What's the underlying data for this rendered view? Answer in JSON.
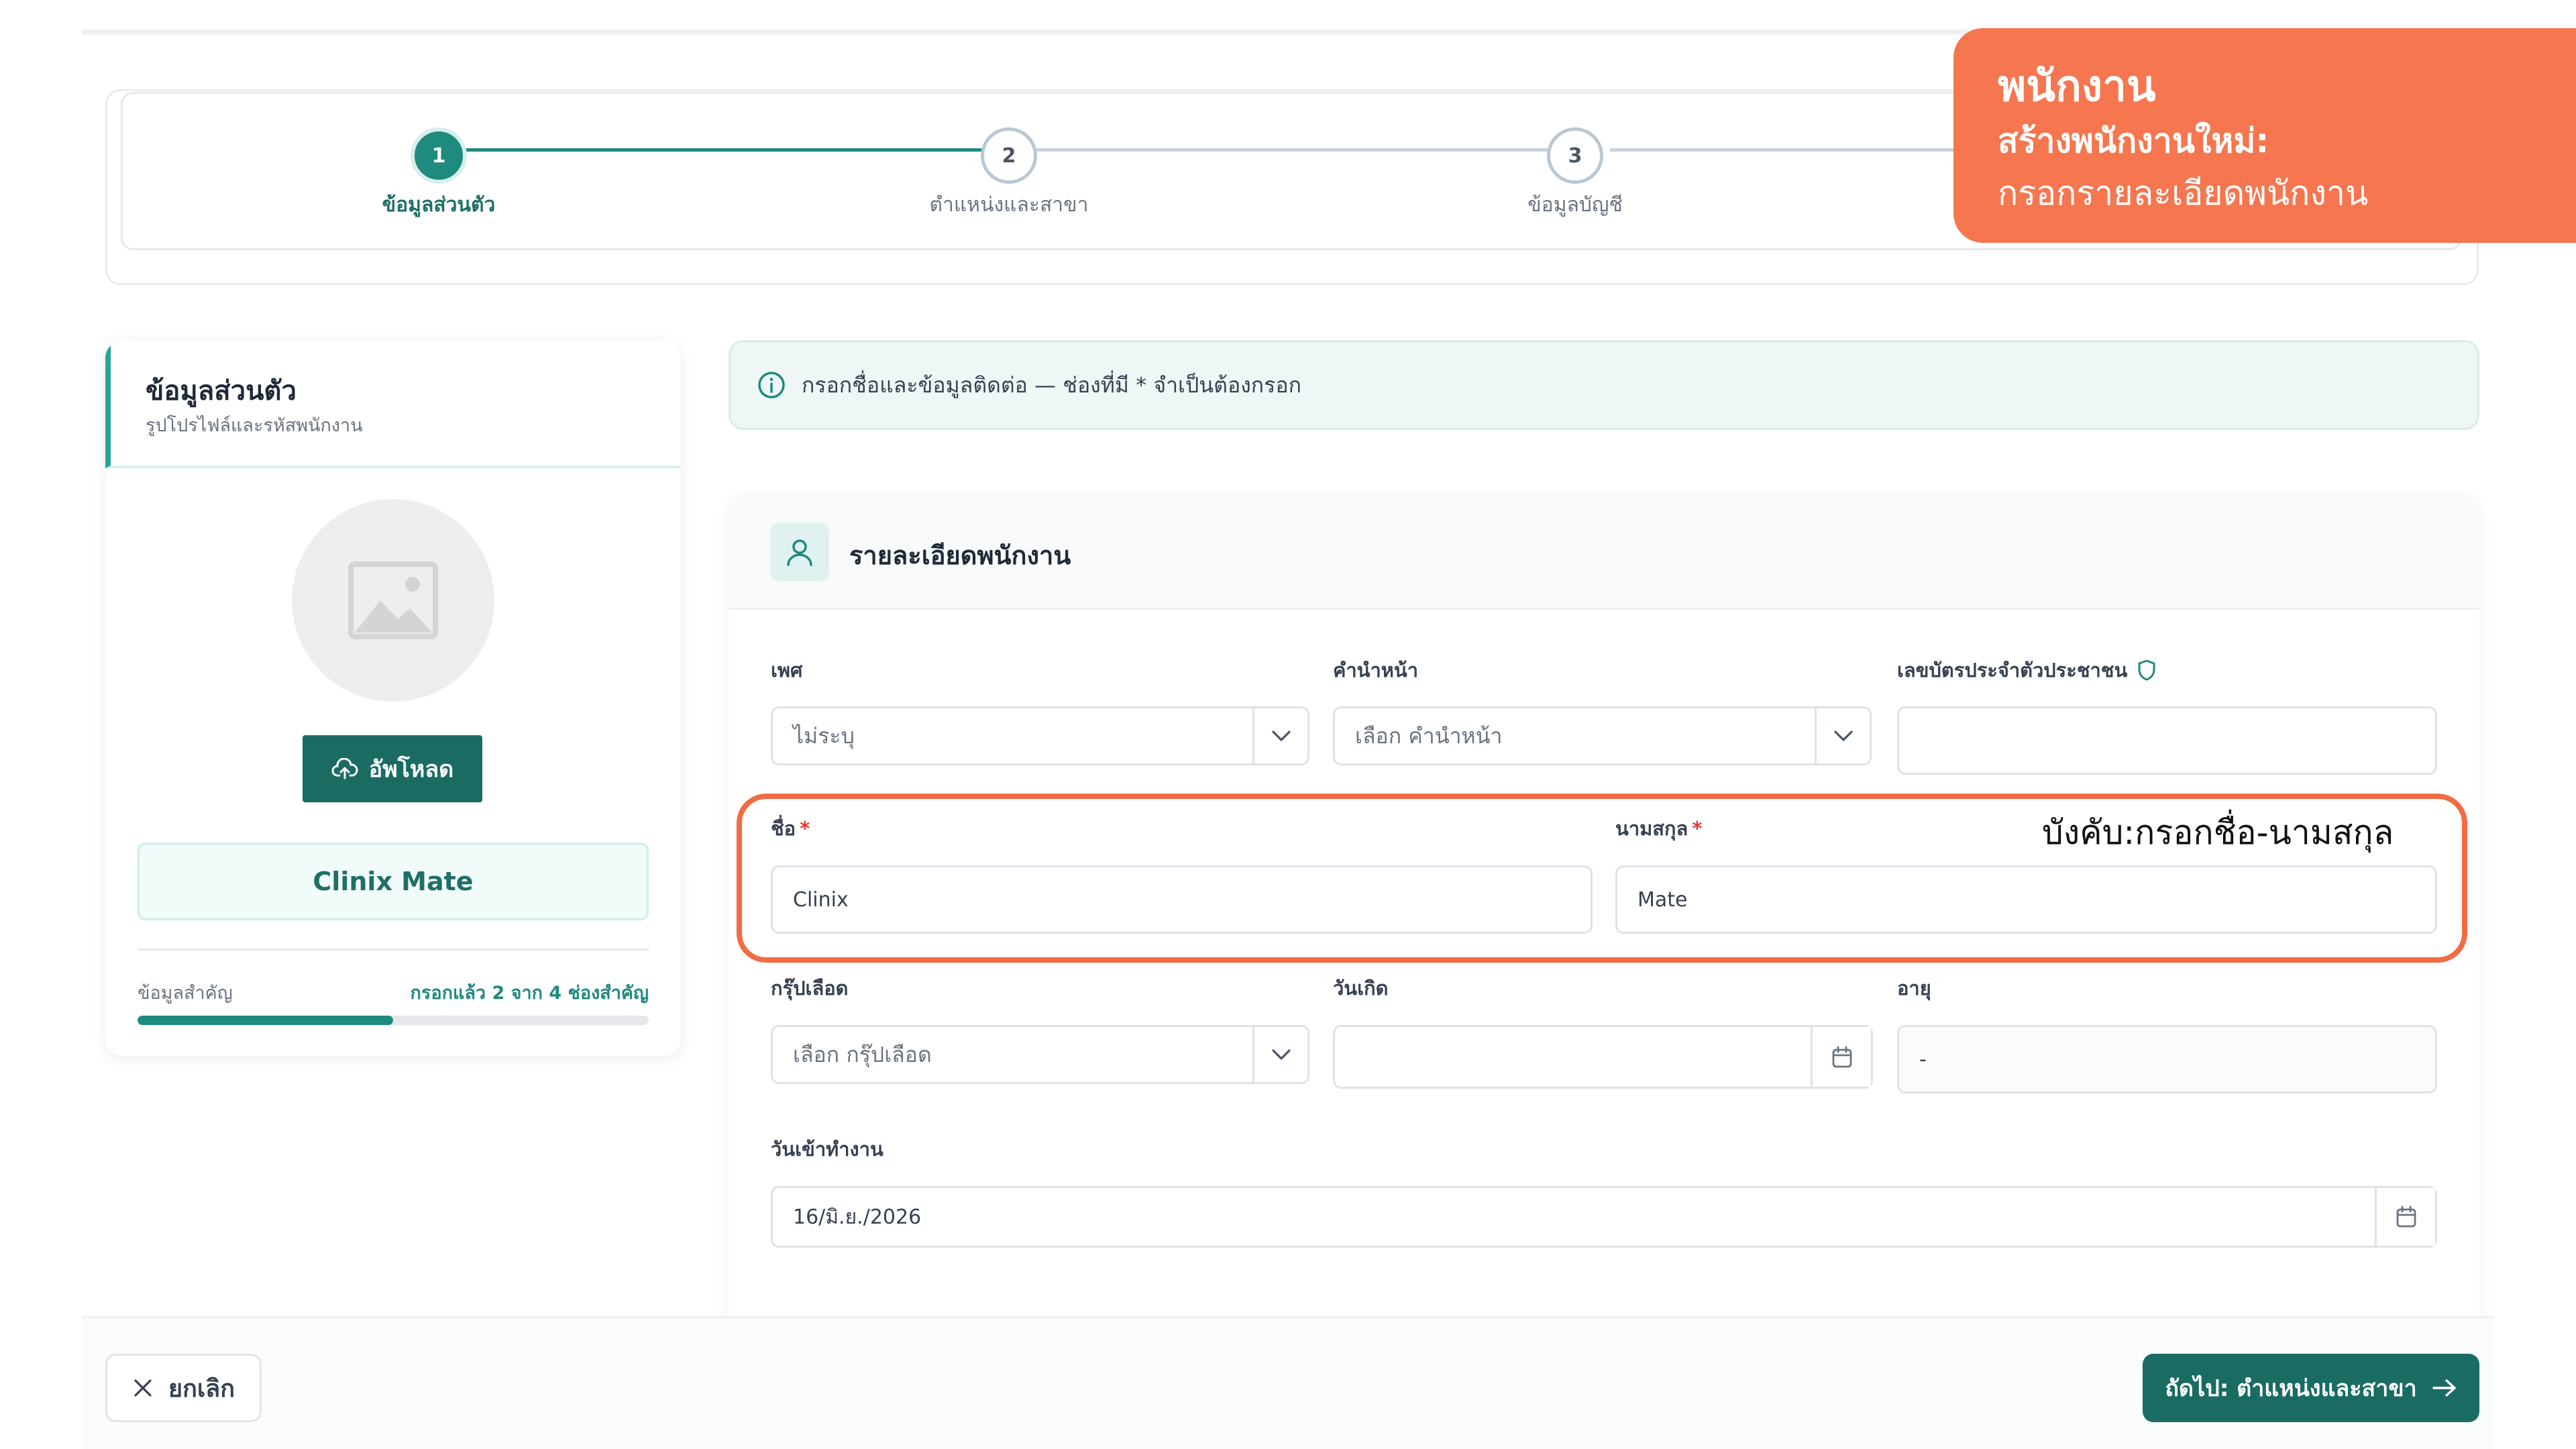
{
  "stepper": {
    "steps": [
      {
        "number": "1",
        "label": "ข้อมูลส่วนตัว",
        "state": "active"
      },
      {
        "number": "2",
        "label": "ตำแหน่งและสาขา",
        "state": "pending"
      },
      {
        "number": "3",
        "label": "ข้อมูลบัญชี",
        "state": "pending"
      }
    ]
  },
  "callout": {
    "title": "พนักงาน",
    "subtitle1": "สร้างพนักงานใหม่:",
    "subtitle2": "กรอกรายละเอียดพนักงาน"
  },
  "left_card": {
    "title": "ข้อมูลส่วนตัว",
    "subtitle": "รูปโปรไฟล์และรหัสพนักงาน",
    "avatar_icon": "image-placeholder-icon",
    "upload_label": "อัพโหลด",
    "display_name": "Clinix Mate",
    "progress_label": "ข้อมูลสำคัญ",
    "progress_status": "กรอกแล้ว 2 จาก 4 ช่องสำคัญ",
    "progress_fraction": 0.5
  },
  "info_banner": {
    "icon": "info-icon",
    "text": "กรอกชื่อและข้อมูลติดต่อ — ช่องที่มี * จำเป็นต้องกรอก"
  },
  "main_card": {
    "title": "รายละเอียดพนักงาน",
    "icon": "person-icon"
  },
  "form": {
    "gender": {
      "label": "เพศ",
      "value": "ไม่ระบุ"
    },
    "prefix": {
      "label": "คำนำหน้า",
      "placeholder": "เลือก คำนำหน้า"
    },
    "national_id": {
      "label": "เลขบัตรประจำตัวประชาชน",
      "value": ""
    },
    "first_name": {
      "label": "ชื่อ",
      "required": "*",
      "value": "Clinix"
    },
    "last_name": {
      "label": "นามสกุล",
      "required": "*",
      "value": "Mate"
    },
    "blood_group": {
      "label": "กรุ๊ปเลือด",
      "placeholder": "เลือก กรุ๊ปเลือด"
    },
    "birth_date": {
      "label": "วันเกิด",
      "value": ""
    },
    "age": {
      "label": "อายุ",
      "value": "-"
    },
    "start_date": {
      "label": "วันเข้าทำงาน",
      "value": "16/มิ.ย./2026"
    }
  },
  "highlight_note": "บังคับ:กรอกชื่อ-นามสกุล",
  "footer": {
    "cancel_label": "ยกเลิก",
    "next_label": "ถัดไป: ตำแหน่งและสาขา"
  },
  "colors": {
    "primary": "#1a6c63",
    "accent": "#1f8a7e",
    "callout": "#f5764f",
    "highlight": "#f26b43"
  }
}
